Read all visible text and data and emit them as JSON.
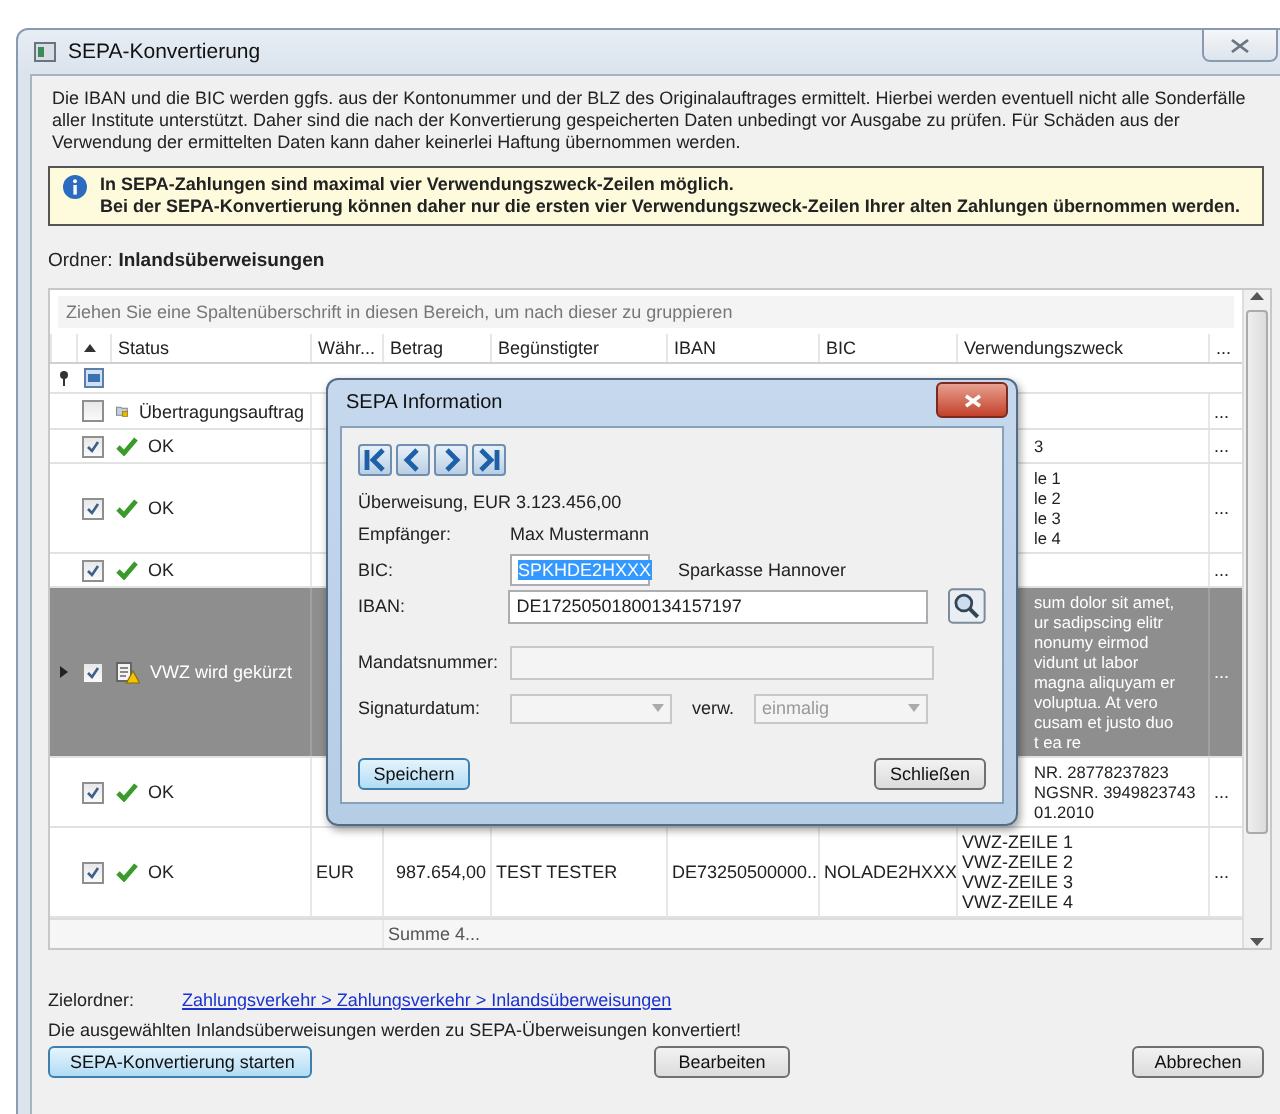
{
  "window": {
    "title": "SEPA-Konvertierung"
  },
  "intro": "Die IBAN und die BIC werden ggfs. aus der Kontonummer und der BLZ des Originalauftrages ermittelt. Hierbei werden eventuell nicht alle Sonderfälle aller Institute unterstützt. Daher sind die nach der Konvertierung gespeicherten Daten unbedingt vor Ausgabe zu prüfen. Für Schäden aus der Verwendung der ermittelten Daten kann daher keinerlei Haftung übernommen werden.",
  "info": {
    "lines": [
      "In SEPA-Zahlungen sind maximal vier Verwendungszweck-Zeilen möglich.",
      "Bei der SEPA-Konvertierung können daher nur die ersten vier Verwendungszweck-Zeilen Ihrer alten Zahlungen übernommen werden."
    ]
  },
  "folder": {
    "label": "Ordner:",
    "value": "Inlandsüberweisungen"
  },
  "grid": {
    "group_hint": "Ziehen Sie eine Spaltenüberschrift in diesen Bereich, um nach dieser zu gruppieren",
    "sort_ascending": true,
    "columns": [
      "Status",
      "Währ...",
      "Betrag",
      "Begünstigter",
      "IBAN",
      "BIC",
      "Verwendungszweck",
      "..."
    ],
    "rows": [
      {
        "kind": "filter",
        "selected": false
      },
      {
        "kind": "transfer",
        "selected": false,
        "checked": false,
        "status": "Übertragungsauftrag",
        "more": "..."
      },
      {
        "kind": "ok",
        "selected": false,
        "checked": true,
        "status": "OK",
        "purpose": [
          "3"
        ],
        "purpose_partial": true,
        "more": "..."
      },
      {
        "kind": "ok",
        "selected": false,
        "checked": true,
        "status": "OK",
        "purpose": [
          "le 1",
          "le 2",
          "le 3",
          "le 4"
        ],
        "purpose_partial": true,
        "more": "..."
      },
      {
        "kind": "ok",
        "selected": false,
        "checked": true,
        "status": "OK",
        "more": "..."
      },
      {
        "kind": "warning",
        "selected": true,
        "checked": true,
        "status": "VWZ wird gekürzt",
        "purpose": [
          "sum dolor sit amet,",
          "ur sadipscing elitr",
          "nonumy eirmod",
          "vidunt ut labor",
          "magna aliquyam er",
          "voluptua. At vero",
          "cusam et justo duo",
          "t ea re"
        ],
        "purpose_partial": true,
        "more": "..."
      },
      {
        "kind": "ok",
        "selected": false,
        "checked": true,
        "status": "OK",
        "purpose": [
          "NR. 28778237823",
          "NGSNR. 3949823743",
          "01.2010"
        ],
        "purpose_partial": true,
        "more": "..."
      },
      {
        "kind": "ok",
        "selected": false,
        "checked": true,
        "status": "OK",
        "currency": "EUR",
        "amount": "987.654,00",
        "beneficiary": "TEST TESTER",
        "iban": "DE73250500000...",
        "bic": "NOLADE2HXXX",
        "purpose": [
          "VWZ-ZEILE 1",
          "VWZ-ZEILE 2",
          "VWZ-ZEILE 3",
          "VWZ-ZEILE 4"
        ],
        "purpose_partial": false,
        "more": "..."
      }
    ],
    "summary": "Summe 4..."
  },
  "dialog": {
    "title": "SEPA Information",
    "nav": [
      {
        "kind": "first"
      },
      {
        "kind": "prev"
      },
      {
        "kind": "next"
      },
      {
        "kind": "last"
      }
    ],
    "heading": "Überweisung, EUR 3.123.456,00",
    "recipient": {
      "label": "Empfänger:",
      "value": "Max Mustermann"
    },
    "bic": {
      "label": "BIC:",
      "value": "SPKHDE2HXXX",
      "text_selected": true,
      "bank": "Sparkasse Hannover"
    },
    "iban": {
      "label": "IBAN:",
      "value": "DE17250501800134157197"
    },
    "mandate": {
      "label": "Mandatsnummer:",
      "disabled": true
    },
    "signature": {
      "label": "Signaturdatum:",
      "disabled": true,
      "usage_label": "verw.",
      "usage_value": "einmalig",
      "usage_disabled": true
    },
    "buttons": [
      {
        "label": "Speichern",
        "default": true
      },
      {
        "label": "Schließen",
        "default": false
      }
    ]
  },
  "target": {
    "label": "Zielordner:",
    "path": "Zahlungsverkehr > Zahlungsverkehr > Inlandsüberweisungen"
  },
  "message": "Die ausgewählten Inlandsüberweisungen werden zu SEPA-Überweisungen konvertiert!",
  "buttons": [
    {
      "label": "SEPA-Konvertierung starten",
      "default": true
    },
    {
      "label": "Bearbeiten",
      "default": false
    },
    {
      "label": "Abbrechen",
      "default": false
    }
  ]
}
